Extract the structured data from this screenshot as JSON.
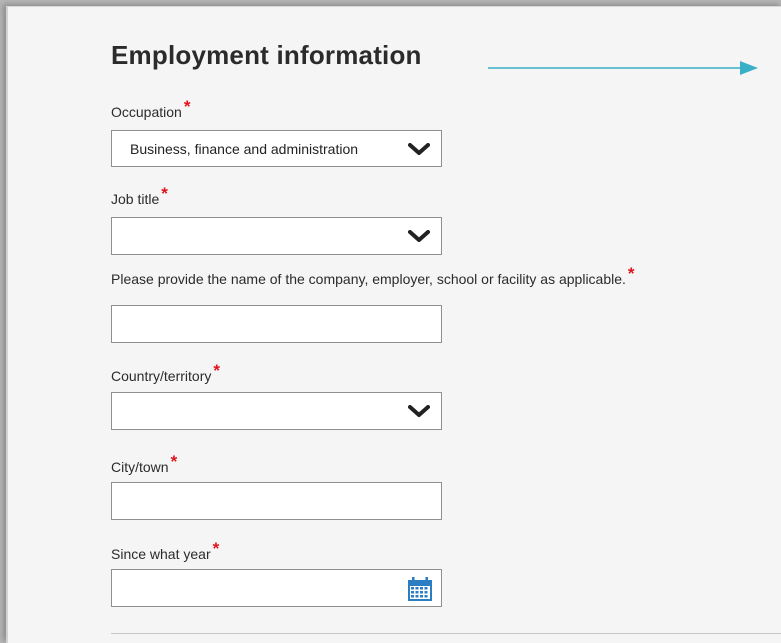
{
  "form": {
    "title": "Employment information",
    "required_marker": "*",
    "fields": {
      "occupation": {
        "label": "Occupation",
        "value": "Business, finance and administration"
      },
      "job_title": {
        "label": "Job title",
        "value": ""
      },
      "company": {
        "label": "Please provide the name of the company, employer, school or facility as applicable.",
        "value": ""
      },
      "country": {
        "label": "Country/territory",
        "value": ""
      },
      "city": {
        "label": "City/town",
        "value": ""
      },
      "since_year": {
        "label": "Since what year",
        "value": ""
      }
    }
  },
  "icons": {
    "dropdown": "chevron-down-icon",
    "calendar": "calendar-icon",
    "annotation": "arrow-right-icon"
  },
  "colors": {
    "required": "#e0131b",
    "arrow": "#3ab0c8",
    "calendar": "#2a7ec1"
  }
}
